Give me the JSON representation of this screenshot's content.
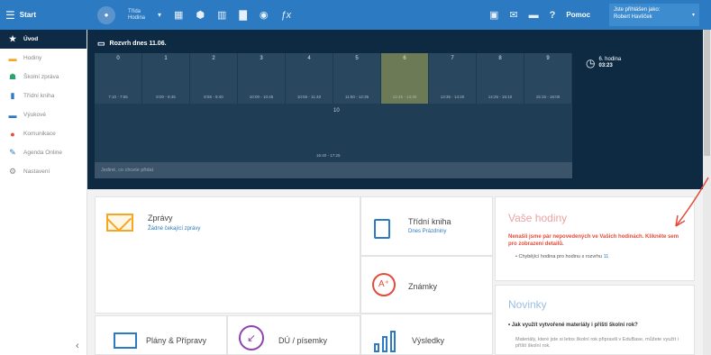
{
  "topbar": {
    "app_title": "Start",
    "class_select": [
      "Třída",
      "Hodina"
    ],
    "help_label": "Pomoc",
    "user_line1": "Jste přihlášen jako:",
    "user_line2": "Robert Havlíček"
  },
  "sidebar": {
    "items": [
      {
        "label": "Úvod",
        "icon": "star-icon",
        "glyph": "★",
        "color": "#0f2a44",
        "active": true
      },
      {
        "label": "Hodiny",
        "icon": "calendar-icon",
        "glyph": "▬",
        "color": "#f5a623"
      },
      {
        "label": "Školní zpráva",
        "icon": "person-icon",
        "glyph": "☗",
        "color": "#2aa46a"
      },
      {
        "label": "Třídní kniha",
        "icon": "book-icon",
        "glyph": "▮",
        "color": "#2c7bc2"
      },
      {
        "label": "Výukové",
        "icon": "folder-icon",
        "glyph": "▬",
        "color": "#2c7bc2"
      },
      {
        "label": "Komunikace",
        "icon": "chat-icon",
        "glyph": "●",
        "color": "#e44b3a"
      },
      {
        "label": "Agenda Online",
        "icon": "pencil-icon",
        "glyph": "✎",
        "color": "#2c7bc2"
      },
      {
        "label": "Nastavení",
        "icon": "gear-icon",
        "glyph": "⚙",
        "color": "#888"
      }
    ]
  },
  "schedule": {
    "heading": "Rozvrh dnes 11.06.",
    "lessons": [
      {
        "num": "0",
        "time": "7:10 - 7:55"
      },
      {
        "num": "1",
        "time": "8:00 - 8:45"
      },
      {
        "num": "2",
        "time": "8:55 - 9:40"
      },
      {
        "num": "3",
        "time": "10:00 - 10:45"
      },
      {
        "num": "4",
        "time": "10:55 - 11:40"
      },
      {
        "num": "5",
        "time": "11:50 - 12:35"
      },
      {
        "num": "6",
        "time": "12:45 - 13:30",
        "current": true
      },
      {
        "num": "7",
        "time": "13:35 - 14:20"
      },
      {
        "num": "8",
        "time": "14:25 - 15:10"
      },
      {
        "num": "9",
        "time": "15:15 - 16:00"
      }
    ],
    "row2_num": "10",
    "row2_time": "16:40 - 17:25",
    "clock_line1": "6. hodina",
    "clock_line2": "03:23",
    "note_placeholder": "Jediné, co chcete přidat"
  },
  "cards": {
    "zpravy": {
      "label": "Zprávy",
      "sub": "Žádné čekající zprávy"
    },
    "kniha": {
      "label": "Třídní kniha",
      "sub": "Dnes Prázdniny"
    },
    "znamky": {
      "label": "Známky"
    },
    "plany": {
      "label": "Plány & Přípravy"
    },
    "du": {
      "label": "DÚ / písemky"
    },
    "vysledky": {
      "label": "Výsledky"
    },
    "hodiny": {
      "title": "Vaše hodiny",
      "warning": "Nenašli jsme pár nepovedených ve Vašich hodinách. Klikněte sem pro zobrazení detailů.",
      "item_text": "Chybějící hodina pro hodinu s rozvrhu",
      "item_link": "11"
    },
    "novinky": {
      "title": "Novinky",
      "question": "Jak využít vytvořené materiály i příští školní rok?",
      "text": "Materiály, které jste si letos školní rok připravili v EduBase, můžete využít i příští školní rok."
    }
  }
}
